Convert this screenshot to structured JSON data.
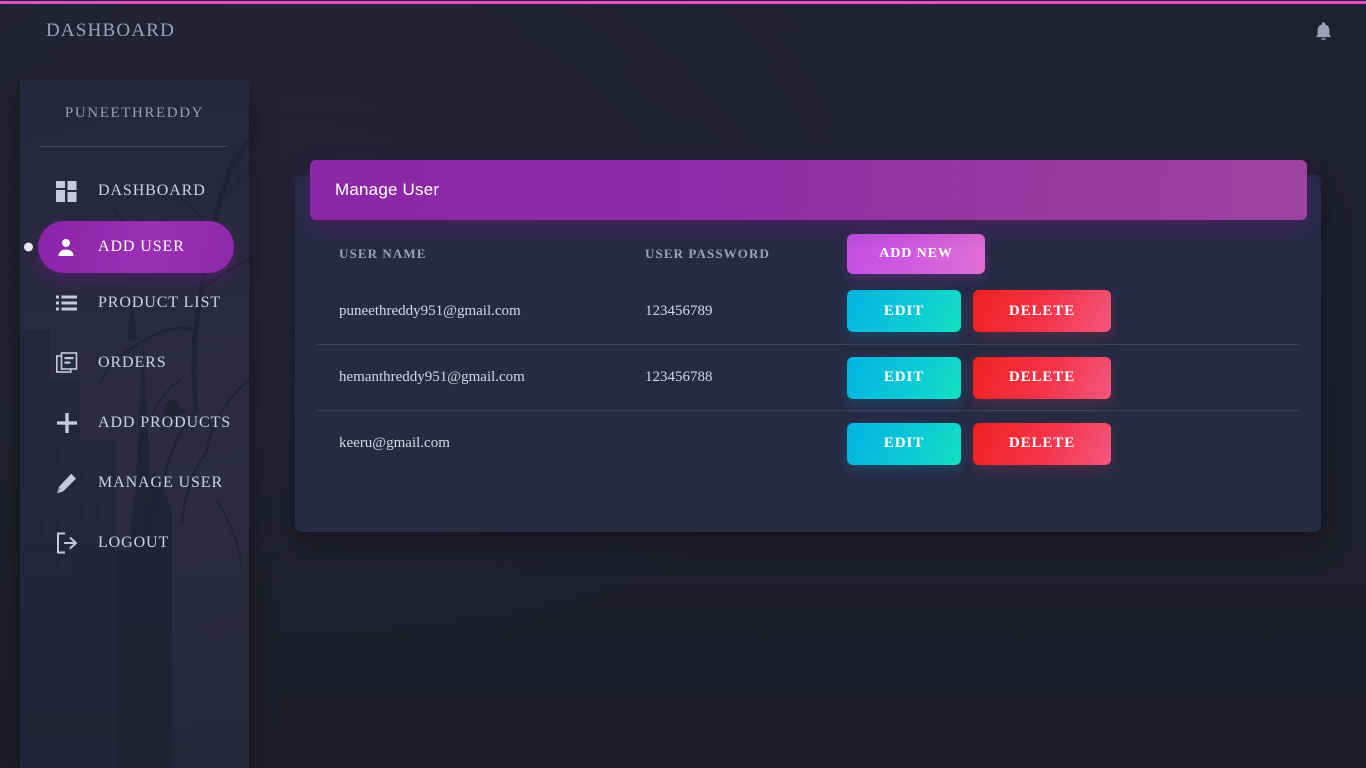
{
  "topbar": {
    "title": "DASHBOARD",
    "bell_icon": "bell-icon"
  },
  "sidebar": {
    "brand": "PUNEETHREDDY",
    "items": [
      {
        "label": "DASHBOARD",
        "icon": "grid-icon",
        "active": false
      },
      {
        "label": "ADD USER",
        "icon": "user-icon",
        "active": true
      },
      {
        "label": "PRODUCT LIST",
        "icon": "list-icon",
        "active": false
      },
      {
        "label": "ORDERS",
        "icon": "documents-icon",
        "active": false
      },
      {
        "label": "ADD PRODUCTS",
        "icon": "plus-icon",
        "active": false
      },
      {
        "label": "MANAGE USER",
        "icon": "pencil-icon",
        "active": false
      },
      {
        "label": "LOGOUT",
        "icon": "logout-icon",
        "active": false
      }
    ]
  },
  "card": {
    "header_title": "Manage User",
    "columns": {
      "user_name": "USER NAME",
      "user_password": "USER PASSWORD"
    },
    "add_new_label": "ADD NEW",
    "rows": [
      {
        "user": "puneethreddy951@gmail.com",
        "password": "123456789",
        "edit_label": "EDIT",
        "delete_label": "DELETE"
      },
      {
        "user": "hemanthreddy951@gmail.com",
        "password": "123456788",
        "edit_label": "EDIT",
        "delete_label": "DELETE"
      },
      {
        "user": "keeru@gmail.com",
        "password": "",
        "edit_label": "EDIT",
        "delete_label": "DELETE"
      }
    ]
  },
  "colors": {
    "page_bg": "#1e1f2b",
    "card_bg": "#262b44",
    "accent_magenta": "#e052c8",
    "accent_purple": "#8b28a6",
    "edit_cyan": "#00b2e0",
    "delete_red": "#f02020",
    "add_new_pink": "#c24fe0"
  }
}
